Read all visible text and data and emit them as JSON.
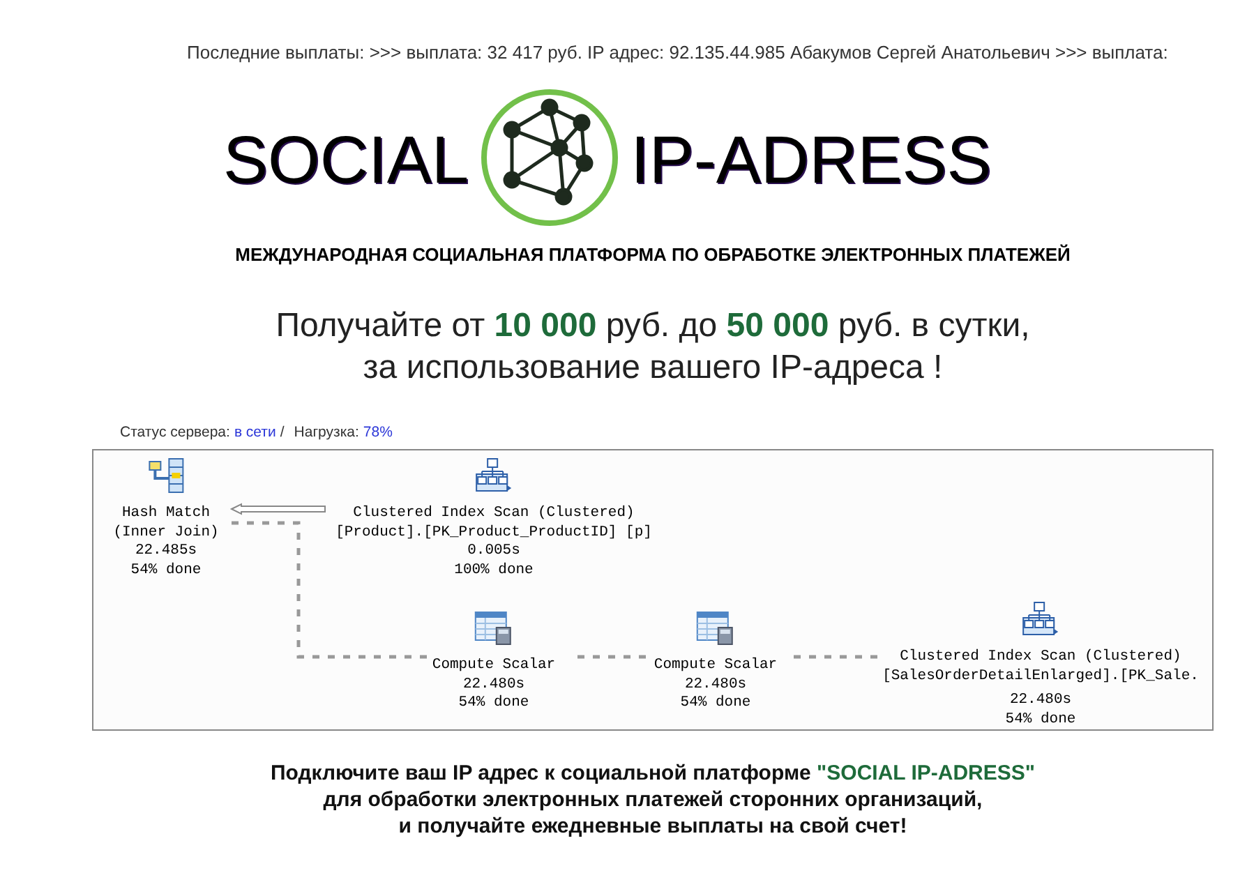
{
  "ticker": "Последние выплаты: >>> выплата: 32 417 руб. IP адрес: 92.135.44.985 Абакумов Сергей Анатольевич >>> выплата:",
  "logo": {
    "left": "SOCIAL",
    "right": "IP-ADRESS"
  },
  "tagline": "МЕЖДУНАРОДНАЯ СОЦИАЛЬНАЯ ПЛАТФОРМА ПО ОБРАБОТКЕ ЭЛЕКТРОННЫХ ПЛАТЕЖЕЙ",
  "headline": [
    "Получайте от **10 000** руб. до **50 000** руб. в сутки,",
    "за использование вашего IP-адреса !"
  ],
  "status": {
    "server_label": "Статус сервера:",
    "server_value": "в сети",
    "separator": "/",
    "load_label": "Нагрузка:",
    "load_value": "78%"
  },
  "plan": {
    "nodes": [
      {
        "kind": "hash",
        "lines": [
          "Hash Match",
          "(Inner Join)",
          "22.485s",
          "54% done"
        ]
      },
      {
        "kind": "scan",
        "lines": [
          "Clustered Index Scan (Clustered)",
          "[Product].[PK_Product_ProductID] [p]",
          "0.005s",
          "100% done"
        ]
      },
      {
        "kind": "compute",
        "lines": [
          "Compute Scalar",
          "22.480s",
          "54% done"
        ]
      },
      {
        "kind": "compute",
        "lines": [
          "Compute Scalar",
          "22.480s",
          "54% done"
        ]
      },
      {
        "kind": "scan",
        "lines": [
          "Clustered Index Scan (Clustered)",
          "[SalesOrderDetailEnlarged].[PK_Sale.",
          "22.480s",
          "54% done"
        ]
      }
    ]
  },
  "footer": [
    "Подключите ваш IP адрес к  социальной платформе  **\"SOCIAL IP-ADRESS\"**",
    "для обработки электронных платежей сторонних организаций,",
    "и получайте ежедневные выплаты на свой счет!"
  ]
}
